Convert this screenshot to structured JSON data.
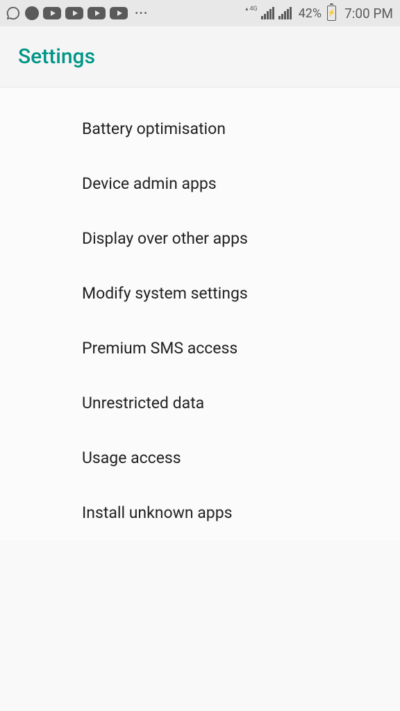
{
  "status_bar": {
    "network_label": "4G",
    "battery_percent": "42%",
    "time": "7:00 PM"
  },
  "header": {
    "title": "Settings"
  },
  "settings": {
    "items": [
      {
        "label": "Battery optimisation"
      },
      {
        "label": "Device admin apps"
      },
      {
        "label": "Display over other apps"
      },
      {
        "label": "Modify system settings"
      },
      {
        "label": "Premium SMS access"
      },
      {
        "label": "Unrestricted data"
      },
      {
        "label": "Usage access"
      },
      {
        "label": "Install unknown apps"
      }
    ]
  }
}
